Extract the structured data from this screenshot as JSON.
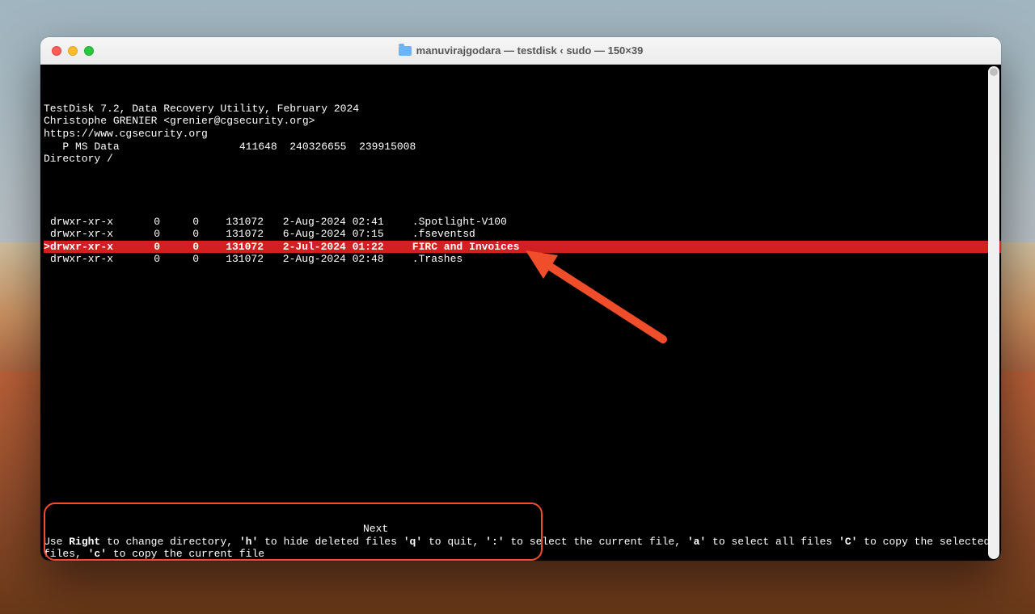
{
  "window": {
    "title": "manuvirajgodara — testdisk ‹ sudo — 150×39"
  },
  "header": {
    "line1": "TestDisk 7.2, Data Recovery Utility, February 2024",
    "line2": "Christophe GRENIER <grenier@cgsecurity.org>",
    "line3": "https://www.cgsecurity.org",
    "partition_line": "   P MS Data                   411648  240326655  239915008",
    "directory_line": "Directory /"
  },
  "files": [
    {
      "selected": false,
      "cursor": " ",
      "perms": "drwxr-xr-x",
      "uid": "0",
      "gid": "0",
      "size": "131072",
      "date": " 2-Aug-2024 02:41",
      "name": ".Spotlight-V100"
    },
    {
      "selected": false,
      "cursor": " ",
      "perms": "drwxr-xr-x",
      "uid": "0",
      "gid": "0",
      "size": "131072",
      "date": " 6-Aug-2024 07:15",
      "name": ".fseventsd"
    },
    {
      "selected": true,
      "cursor": ">",
      "perms": "drwxr-xr-x",
      "uid": "0",
      "gid": "0",
      "size": "131072",
      "date": " 2-Jul-2024 01:22",
      "name": "FIRC and Invoices"
    },
    {
      "selected": false,
      "cursor": " ",
      "perms": "drwxr-xr-x",
      "uid": "0",
      "gid": "0",
      "size": "131072",
      "date": " 2-Aug-2024 02:48",
      "name": ".Trashes"
    }
  ],
  "footer": {
    "next": "Next",
    "line1_a": "Use ",
    "line1_b": "Right",
    "line1_c": " to change directory, ",
    "line1_d": "'h'",
    "line1_e": " to hide deleted files",
    "line2_a": "    ",
    "line2_b": "'q'",
    "line2_c": " to quit, ",
    "line2_d": "':'",
    "line2_e": " to select the current file, ",
    "line2_f": "'a'",
    "line2_g": " to select all files",
    "line3_a": "    ",
    "line3_b": "'C'",
    "line3_c": " to copy the selected files, ",
    "line3_d": "'c'",
    "line3_e": " to copy the current file"
  },
  "annotation": {
    "arrow_color": "#f04d2a",
    "box_color": "#f04d2a"
  }
}
